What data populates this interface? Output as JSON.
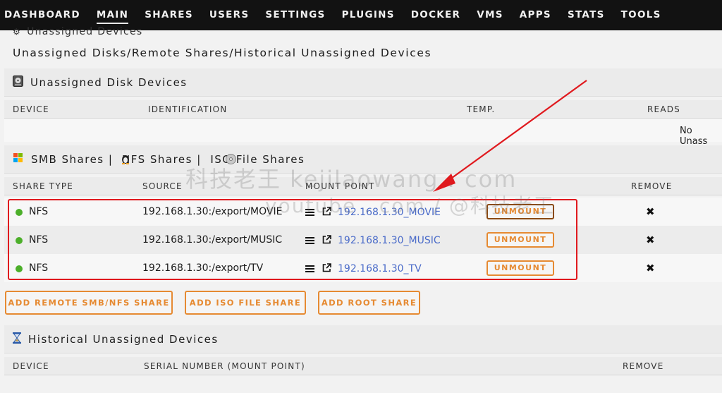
{
  "nav": {
    "items": [
      "DASHBOARD",
      "MAIN",
      "SHARES",
      "USERS",
      "SETTINGS",
      "PLUGINS",
      "DOCKER",
      "VMS",
      "APPS",
      "STATS",
      "TOOLS"
    ],
    "active": "MAIN"
  },
  "top": {
    "cut_title": "Unassigned Devices",
    "subtitle": "Unassigned Disks/Remote Shares/Historical Unassigned Devices"
  },
  "disk_section": {
    "title": "Unassigned Disk Devices",
    "icon": "hard-disk-icon",
    "columns": [
      "DEVICE",
      "IDENTIFICATION",
      "TEMP.",
      "READS"
    ],
    "empty_text": "No Unass"
  },
  "shares_section": {
    "title": "SMB Shares |  NFS Shares |  ISO File Shares",
    "columns": [
      "SHARE TYPE",
      "SOURCE",
      "MOUNT POINT",
      "REMOVE"
    ],
    "rows": [
      {
        "type": "NFS",
        "source": "192.168.1.30:/export/MOVIE",
        "mount": "192.168.1.30_MOVIE",
        "action": "UNMOUNT",
        "status": "online"
      },
      {
        "type": "NFS",
        "source": "192.168.1.30:/export/MUSIC",
        "mount": "192.168.1.30_MUSIC",
        "action": "UNMOUNT",
        "status": "online"
      },
      {
        "type": "NFS",
        "source": "192.168.1.30:/export/TV",
        "mount": "192.168.1.30_TV",
        "action": "UNMOUNT",
        "status": "online"
      }
    ],
    "buttons": [
      "ADD REMOTE SMB/NFS SHARE",
      "ADD ISO FILE SHARE",
      "ADD ROOT SHARE"
    ]
  },
  "historical_section": {
    "title": "Historical Unassigned Devices",
    "icon": "hourglass-icon",
    "columns": [
      "DEVICE",
      "SERIAL NUMBER (MOUNT POINT)",
      "REMOVE"
    ]
  },
  "watermark": {
    "line1": "科技老王 kejilaowang . com",
    "line2": "youtube . com / @科技老王"
  },
  "colors": {
    "nav_bg": "#121212",
    "accent": "#e68a32",
    "link": "#4a6bc9",
    "status_online": "#4caf2a",
    "highlight": "#e0191e"
  }
}
